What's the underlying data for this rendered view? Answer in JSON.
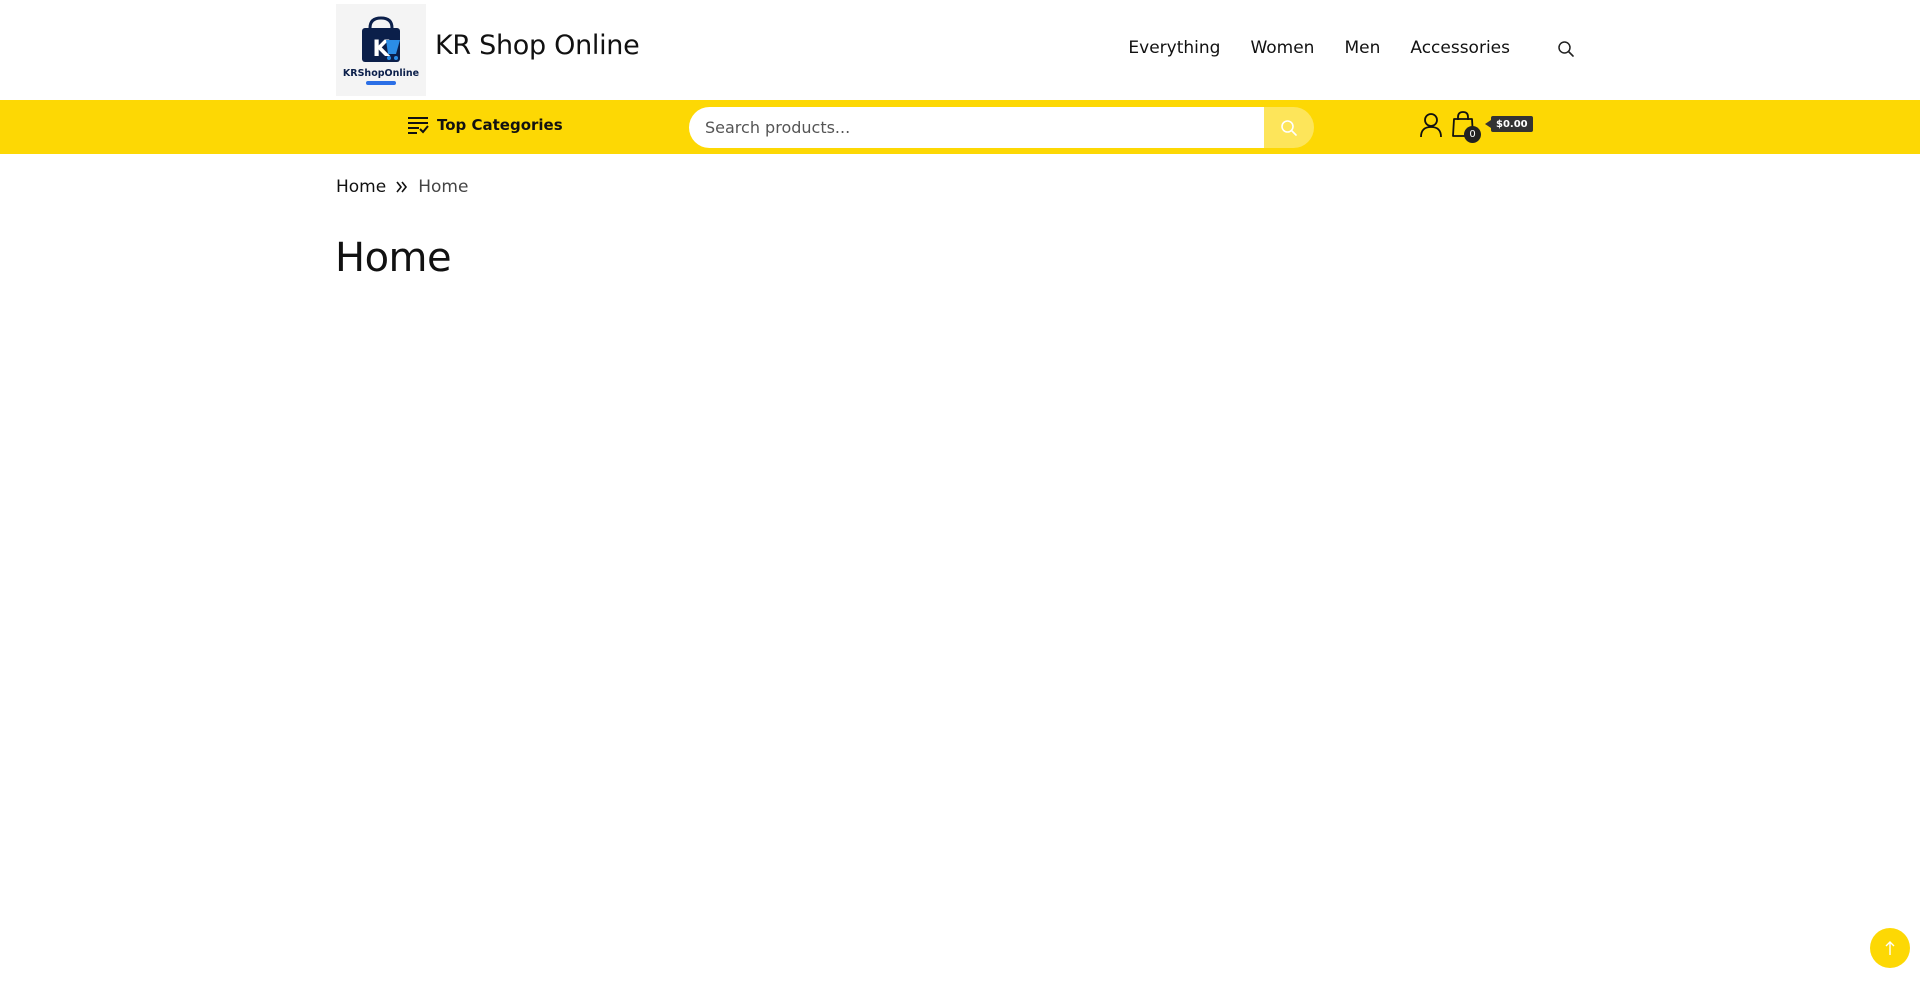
{
  "header": {
    "logo_text": "KRShopOnline",
    "site_title": "KR Shop Online",
    "nav": [
      {
        "label": "Everything"
      },
      {
        "label": "Women"
      },
      {
        "label": "Men"
      },
      {
        "label": "Accessories"
      }
    ],
    "search_icon": "search-icon"
  },
  "bar": {
    "top_categories_label": "Top Categories",
    "search_placeholder": "Search products...",
    "cart_count": "0",
    "cart_total": "$0.00",
    "colors": {
      "bar": "#fdd804",
      "search_button": "#fde55a"
    }
  },
  "breadcrumb": {
    "items": [
      "Home",
      "Home"
    ]
  },
  "page": {
    "title": "Home"
  }
}
